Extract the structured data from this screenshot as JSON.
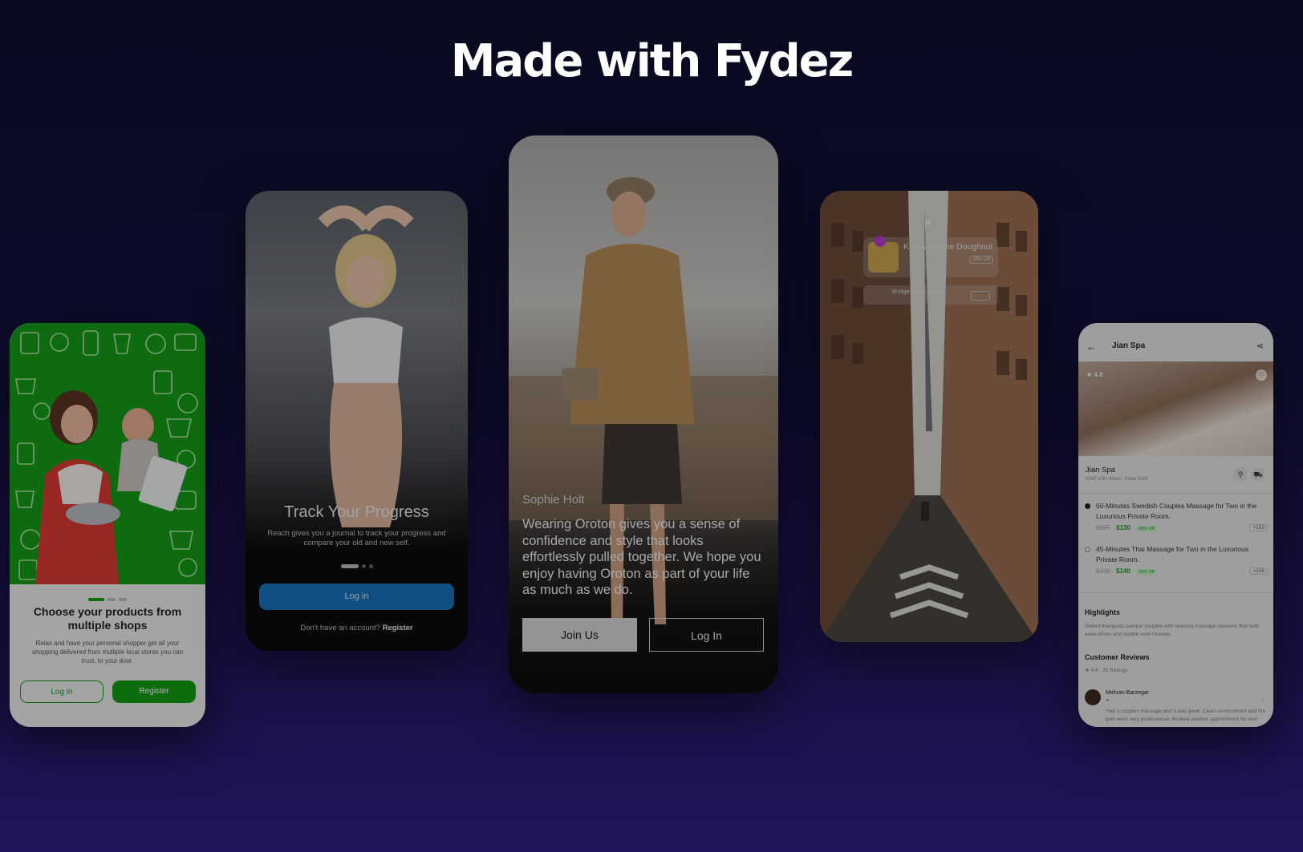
{
  "headline": "Made with Fydez",
  "grocery": {
    "title": "Choose your products from multiple shops",
    "description": "Relax and have your personal shopper get all your shopping delivered from multiple local stores you can trust, to your door.",
    "login_label": "Log in",
    "register_label": "Register"
  },
  "fitness": {
    "title": "Track Your Progress",
    "description": "Reach gives you a journal to track your progress and compare your old and new self.",
    "login_label": "Log in",
    "account_prompt": "Don't have an account?",
    "register_label": "Register"
  },
  "fashion": {
    "name": "Sophie Holt",
    "quote": "Wearing Oroton gives you a sense of confidence and style that looks effortlessly pulled together. We hope you enjoy having Oroton as part of your life as much as we do.",
    "join_label": "Join Us",
    "login_label": "Log In"
  },
  "ar_map": {
    "place_title": "Krispy Kreme Doughnut",
    "street_label": "Bridge stone street",
    "discount": "25% Off"
  },
  "spa": {
    "header_title": "Jian Spa",
    "rating": "4.8",
    "business_name": "Jian Spa",
    "address": "9245 10th Street, Tinley Park",
    "services": [
      {
        "name": "60-Minutes Swedish Couples Massage for Two in the Luxurious Private Room.",
        "old_price": "$225",
        "new_price": "$130",
        "discount": "38% Off",
        "count": "+163",
        "selected": true
      },
      {
        "name": "45-Minutes Thai Massage for Two in the Luxurious Private Room.",
        "old_price": "$195",
        "new_price": "$140",
        "discount": "25% Off",
        "count": "+208",
        "selected": false
      }
    ],
    "highlights_title": "Highlights",
    "highlights_text": "Skilled therapists pamper couples with relaxing massage sessions that help ease stress and soothe sore muscles.",
    "reviews_title": "Customer Reviews",
    "reviews_summary": "4.8 . 25 Ratings",
    "reviewer_name": "Mehran Barzegar",
    "review_text": "Had a couples massage and it was great. Clean environment and the gals were very professional. Booked another appointment for next"
  }
}
